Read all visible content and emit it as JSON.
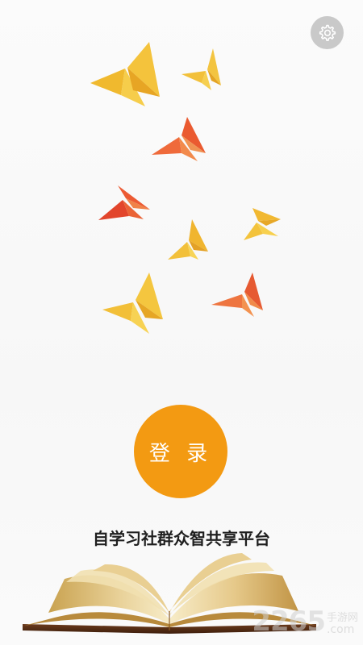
{
  "header": {
    "settings_icon": "gear-icon"
  },
  "hero": {
    "illustration": "origami-butterflies",
    "colors": {
      "yellow": "#f3c23a",
      "orange": "#ee6a3a",
      "red": "#e2452c"
    }
  },
  "login": {
    "label": "登 录",
    "color": "#f39a12"
  },
  "tagline": "自学习社群众智共享平台",
  "footer": {
    "illustration": "open-book"
  },
  "watermark": {
    "number": "2265",
    "cn": "手游网",
    "domain": ".com"
  }
}
